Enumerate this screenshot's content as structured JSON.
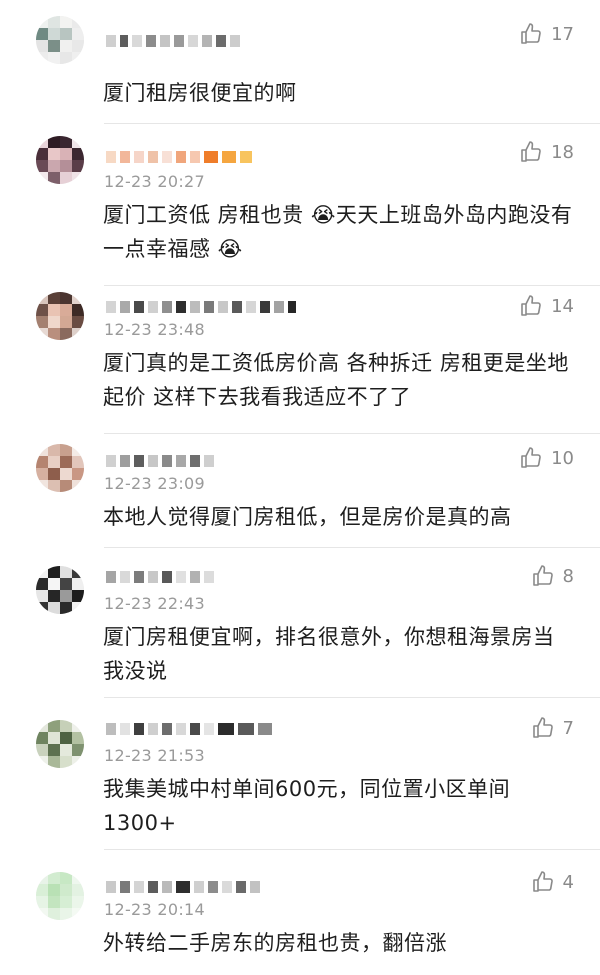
{
  "comments": [
    {
      "text": "厦门租房很便宜的啊",
      "time": "",
      "likes": "17"
    },
    {
      "text": "厦门工资低  房租也贵 😭天天上班岛外岛内跑没有一点幸福感 😭",
      "time": "12-23 20:27",
      "likes": "18"
    },
    {
      "text": "厦门真的是工资低房价高 各种拆迁 房租更是坐地起价 这样下去我看我适应不了了",
      "time": "12-23 23:48",
      "likes": "14"
    },
    {
      "text": "本地人觉得厦门房租低，但是房价是真的高",
      "time": "12-23 23:09",
      "likes": "10"
    },
    {
      "text": "厦门房租便宜啊，排名很意外，你想租海景房当我没说",
      "time": "12-23 22:43",
      "likes": "8"
    },
    {
      "text": "我集美城中村单间600元，同位置小区单间1300+",
      "time": "12-23 21:53",
      "likes": "7"
    },
    {
      "text": "外转给二手房东的房租也贵，翻倍涨",
      "time": "12-23 20:14",
      "likes": "4"
    }
  ],
  "icons": {
    "like": "thumbs-up-icon"
  },
  "colors": {
    "text": "#1e1e1e",
    "meta": "#9a9a9a",
    "divider": "#e6e6e6"
  }
}
